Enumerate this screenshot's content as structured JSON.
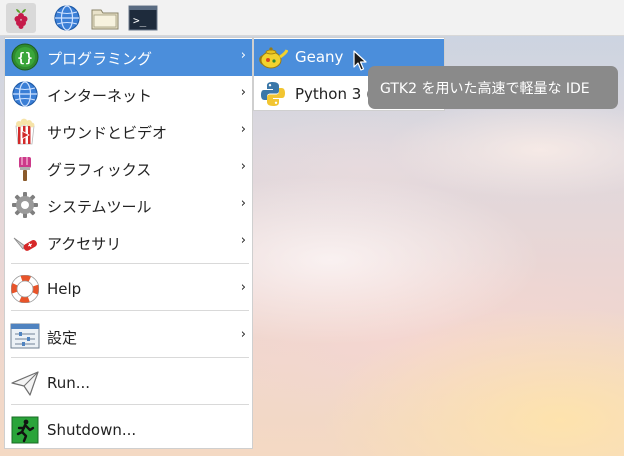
{
  "taskbar": {
    "buttons": [
      {
        "name": "raspberry-menu-icon"
      },
      {
        "name": "web-browser-icon"
      },
      {
        "name": "file-manager-icon"
      },
      {
        "name": "terminal-icon"
      }
    ]
  },
  "menu": {
    "items": [
      {
        "label": "プログラミング",
        "icon": "programming-icon",
        "has_submenu": true,
        "highlighted": true
      },
      {
        "label": "インターネット",
        "icon": "internet-globe-icon",
        "has_submenu": true
      },
      {
        "label": "サウンドとビデオ",
        "icon": "sound-video-icon",
        "has_submenu": true
      },
      {
        "label": "グラフィックス",
        "icon": "graphics-brush-icon",
        "has_submenu": true
      },
      {
        "label": "システムツール",
        "icon": "system-gear-icon",
        "has_submenu": true
      },
      {
        "label": "アクセサリ",
        "icon": "accessories-knife-icon",
        "has_submenu": true
      },
      {
        "label": "Help",
        "icon": "help-lifebuoy-icon",
        "has_submenu": true
      },
      {
        "label": "設定",
        "icon": "settings-panel-icon",
        "has_submenu": true
      },
      {
        "label": "Run...",
        "icon": "run-paper-plane-icon",
        "has_submenu": false
      },
      {
        "label": "Shutdown...",
        "icon": "shutdown-exit-icon",
        "has_submenu": false
      }
    ],
    "arrow": "›"
  },
  "submenu": {
    "items": [
      {
        "label": "Geany",
        "icon": "geany-teapot-icon",
        "highlighted": true
      },
      {
        "label": "Python 3 (",
        "icon": "python-icon"
      }
    ]
  },
  "tooltip": {
    "text": "GTK2 を用いた高速で軽量な IDE"
  },
  "colors": {
    "highlight": "#4b8edb",
    "tooltip_bg": "#8a8a8a",
    "taskbar_bg": "#f2f2f2"
  }
}
